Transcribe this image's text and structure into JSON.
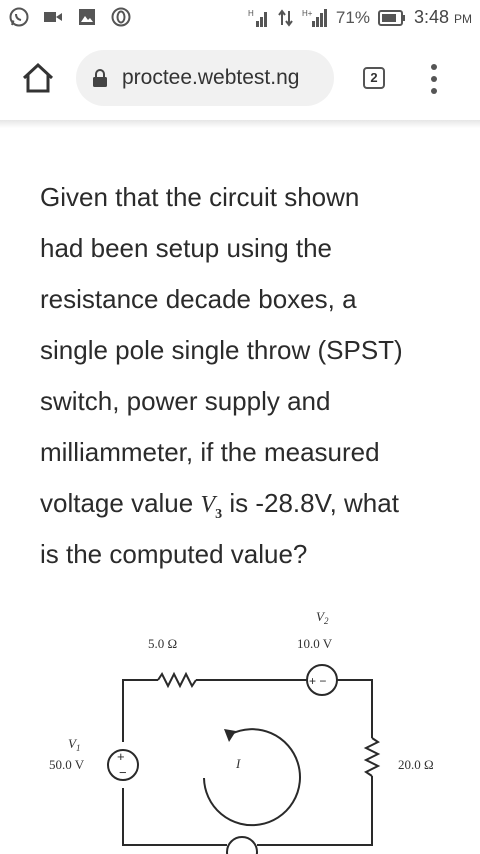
{
  "status_bar": {
    "battery": "71%",
    "time": "3:48",
    "ampm": "PM",
    "icons": [
      "whatsapp-icon",
      "video-icon",
      "gallery-icon",
      "opera-icon",
      "signal-icon",
      "data-icon",
      "signal2-icon",
      "battery-icon"
    ]
  },
  "browser": {
    "url": "proctee.webtest.ng",
    "tab_count": "2"
  },
  "question": {
    "lines": [
      "Given that the circuit shown",
      "had been setup using the",
      "resistance decade boxes, a",
      "single pole single throw (SPST)",
      "switch, power supply and",
      "milliammeter, if the measured"
    ],
    "line7_before": "voltage value ",
    "v3_symbol": "V",
    "v3_sub": "3",
    "line7_after": " is -28.8V, what",
    "line8": "is the computed value?"
  },
  "circuit": {
    "r1_label": "5.0 Ω",
    "v2_name": "V",
    "v2_sub": "2",
    "v2_value": "10.0 V",
    "v1_name": "V",
    "v1_sub": "1",
    "v1_value": "50.0 V",
    "current_label": "I",
    "r2_label": "20.0 Ω"
  }
}
